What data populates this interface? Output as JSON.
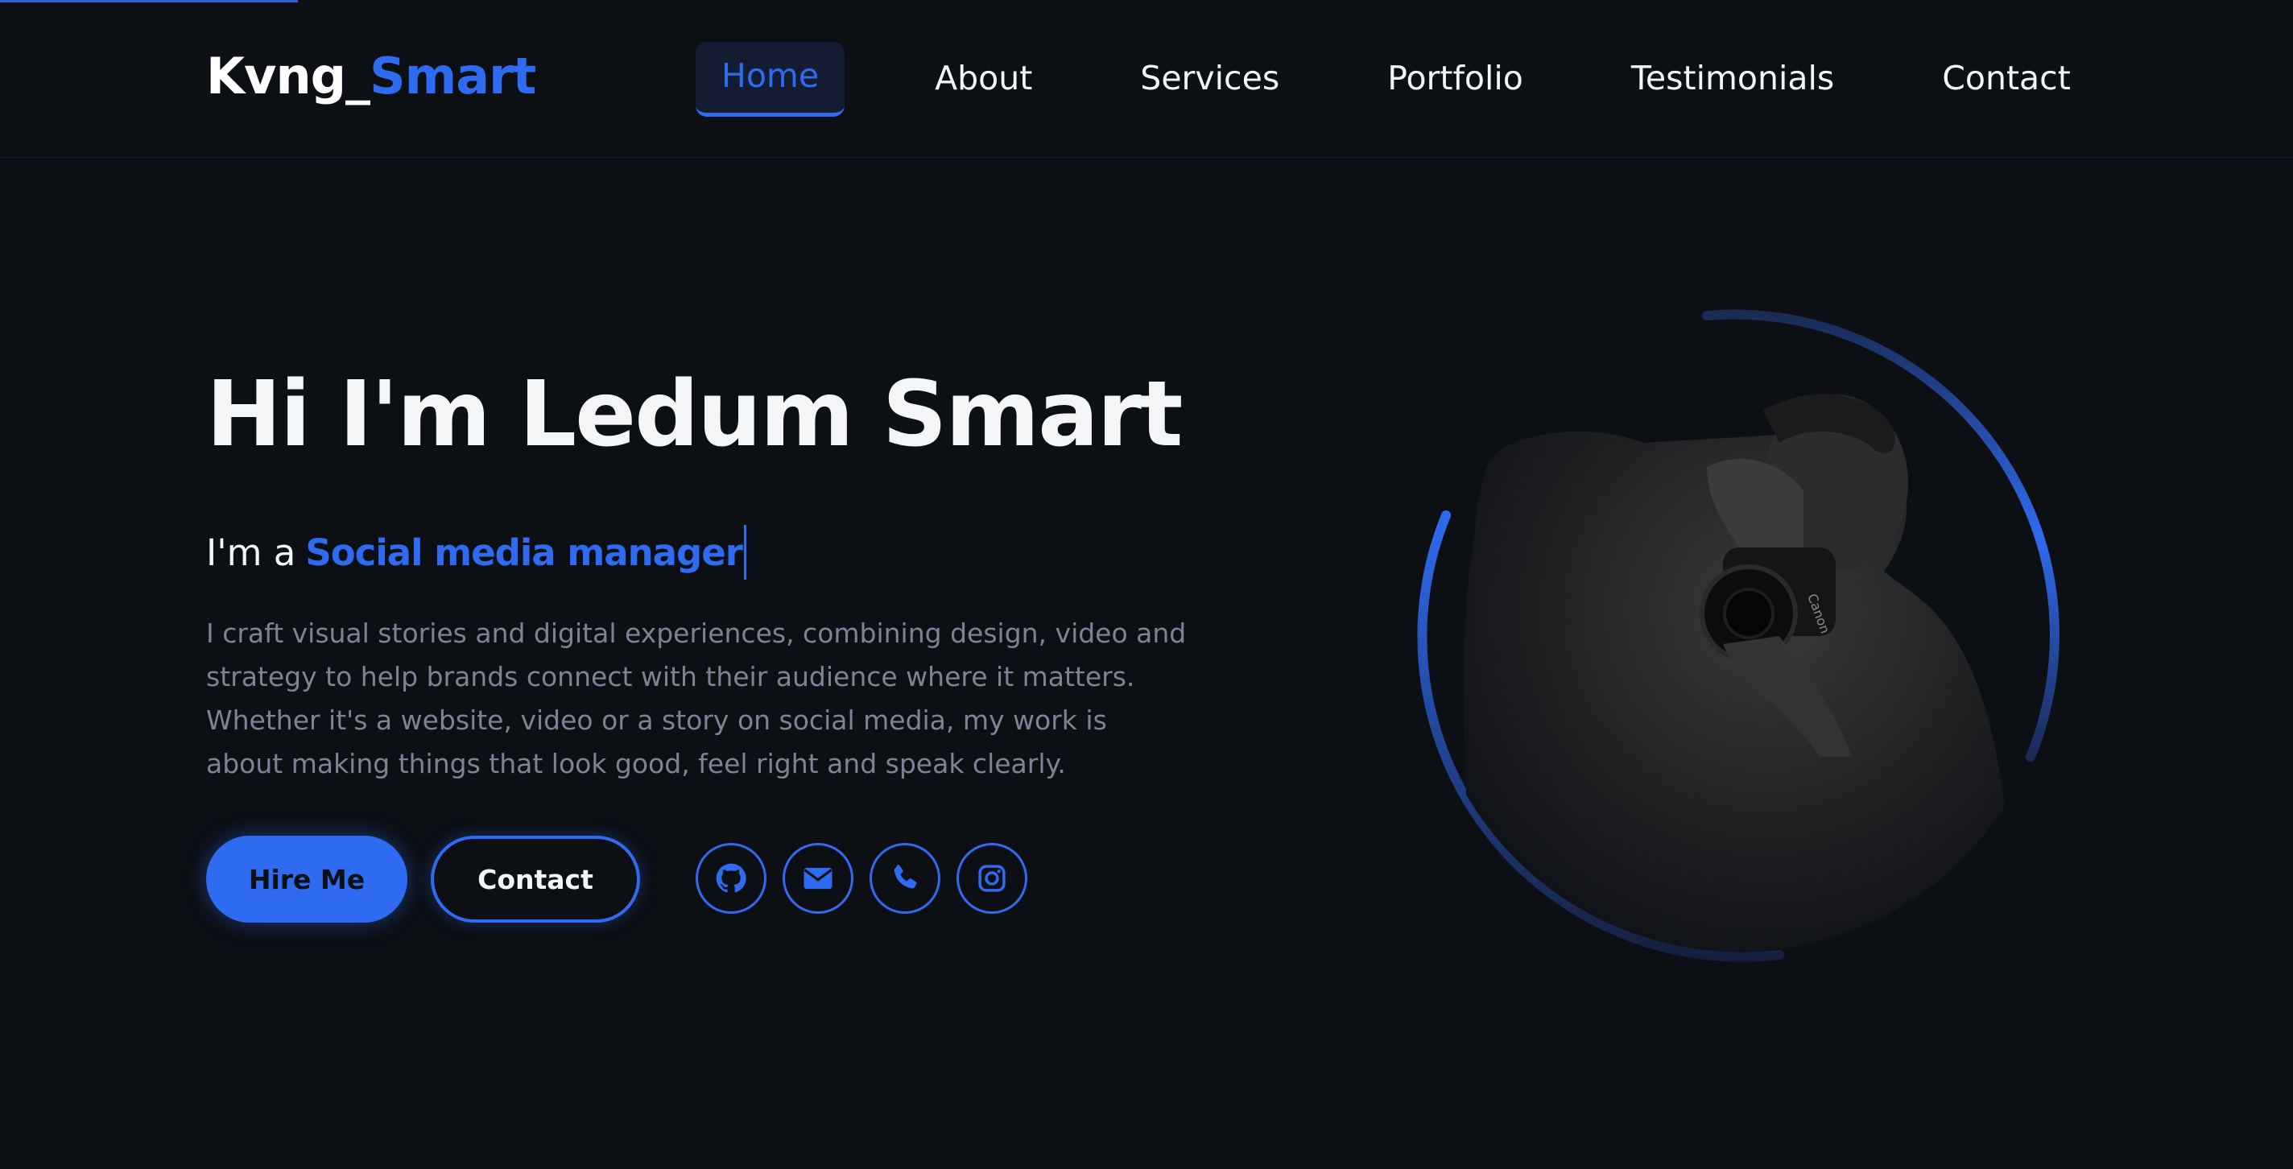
{
  "app": {
    "scroll_progress": 0.13
  },
  "header": {
    "logo_part1": "Kvng_",
    "logo_part2": "Smart",
    "nav": [
      {
        "label": "Home",
        "active": true
      },
      {
        "label": "About",
        "active": false
      },
      {
        "label": "Services",
        "active": false
      },
      {
        "label": "Portfolio",
        "active": false
      },
      {
        "label": "Testimonials",
        "active": false
      },
      {
        "label": "Contact",
        "active": false
      }
    ]
  },
  "hero": {
    "title": "Hi I'm Ledum Smart",
    "subtitle_prefix": "I'm a",
    "subtitle_role": "Social media manager",
    "description": "I craft visual stories and digital experiences, combining design, video and strategy to help brands connect with their audience where it matters. Whether it's a website, video or a story on social media, my work is about making things that look good, feel right and speak clearly.",
    "buttons": {
      "hire": "Hire Me",
      "contact": "Contact"
    },
    "socials": [
      {
        "icon": "github-icon"
      },
      {
        "icon": "envelope-icon"
      },
      {
        "icon": "phone-icon"
      },
      {
        "icon": "instagram-icon"
      }
    ],
    "portrait_label": "Canon"
  },
  "colors": {
    "background": "#0c0f14",
    "accent": "#2f6bf0",
    "text": "#f4f5f7",
    "muted": "#7b8497"
  }
}
